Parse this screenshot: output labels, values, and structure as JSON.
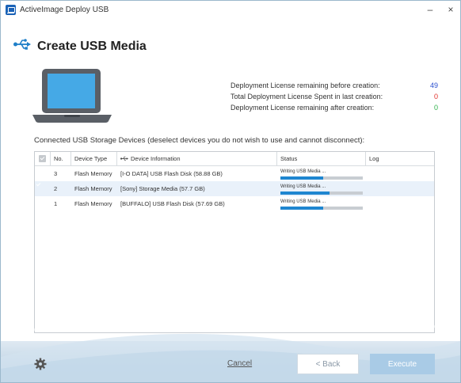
{
  "window": {
    "title": "ActiveImage Deploy USB",
    "minimize_label": "–",
    "close_label": "×"
  },
  "heading": {
    "title": "Create USB Media",
    "icon": "usb-icon"
  },
  "illustration": {
    "icon": "laptop-icon"
  },
  "license": {
    "rows": [
      {
        "label": "Deployment License remaining before creation:",
        "value": "49",
        "color": "#2a4fcf"
      },
      {
        "label": "Total Deployment License Spent in last creation:",
        "value": "0",
        "color": "#e0302a"
      },
      {
        "label": "Deployment License remaining after creation:",
        "value": "0",
        "color": "#2eb24a"
      }
    ]
  },
  "devices": {
    "label": "Connected USB Storage Devices (deselect devices you do not wish to use and cannot disconnect):",
    "columns": {
      "no": "No.",
      "type": "Device Type",
      "info": "Device Information",
      "status": "Status",
      "log": "Log"
    },
    "rows": [
      {
        "checked": true,
        "no": "3",
        "type": "Flash Memory",
        "info": "[I-O DATA] USB Flash Disk (58.88 GB)",
        "status": "Writing USB Media ...",
        "progress": 0.52,
        "log": ""
      },
      {
        "checked": true,
        "no": "2",
        "type": "Flash Memory",
        "info": "[Sony] Storage Media (57.7 GB)",
        "status": "Writing USB Media ...",
        "progress": 0.6,
        "log": ""
      },
      {
        "checked": true,
        "no": "1",
        "type": "Flash Memory",
        "info": "[BUFFALO] USB Flash Disk (57.69 GB)",
        "status": "Writing USB Media ...",
        "progress": 0.52,
        "log": ""
      }
    ]
  },
  "footer": {
    "settings_icon": "gear-icon",
    "cancel_label": "Cancel",
    "back_label": "< Back",
    "execute_label": "Execute"
  },
  "colors": {
    "accent": "#1f86d0",
    "execute_bg": "#a9cbe6",
    "row_alt": "#e9f1fa"
  }
}
